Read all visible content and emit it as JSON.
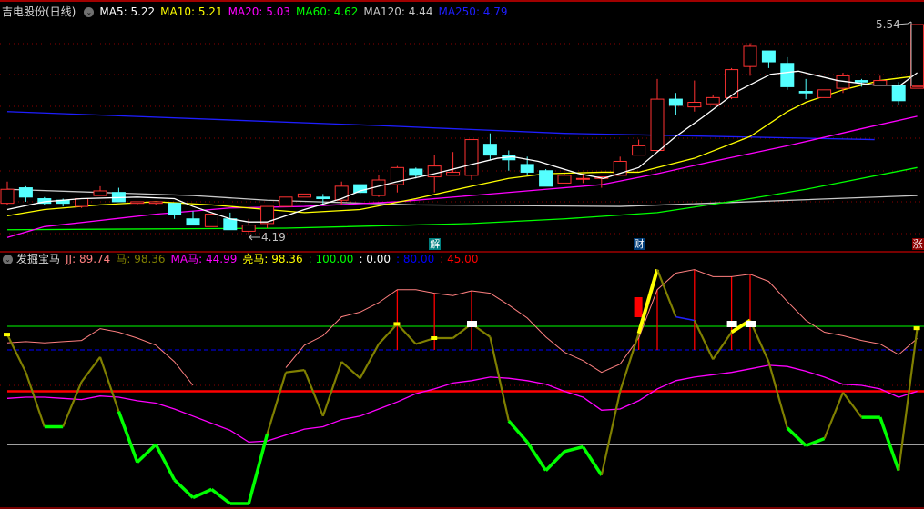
{
  "title": "吉电股份(日线)",
  "ma_labels": [
    {
      "label": "MA5",
      "value": "5.22",
      "color": "#ffffff"
    },
    {
      "label": "MA10",
      "value": "5.21",
      "color": "#ffff00"
    },
    {
      "label": "MA20",
      "value": "5.03",
      "color": "#ff00ff"
    },
    {
      "label": "MA60",
      "value": "4.62",
      "color": "#00ff00"
    },
    {
      "label": "MA120",
      "value": "4.44",
      "color": "#c8c8c8"
    },
    {
      "label": "MA250",
      "value": "4.79",
      "color": "#1e1eff"
    }
  ],
  "indicator": {
    "name": "发掘宝马",
    "items": [
      {
        "label": "JJ",
        "value": "89.74",
        "color": "#ff8080"
      },
      {
        "label": "马",
        "value": "98.36",
        "color": "#808000"
      },
      {
        "label": "MA马",
        "value": "44.99",
        "color": "#ff00ff"
      },
      {
        "label": "亮马",
        "value": "98.36",
        "color": "#ffff00"
      },
      {
        "label": "",
        "value": "100.00",
        "color": "#00ff00"
      },
      {
        "label": "",
        "value": "0.00",
        "color": "#ffffff"
      },
      {
        "label": "",
        "value": "80.00",
        "color": "#0000ff"
      },
      {
        "label": "",
        "value": "45.00",
        "color": "#ff0000"
      }
    ]
  },
  "markers": [
    {
      "text": "解",
      "index": 23,
      "color": "#008080"
    },
    {
      "text": "财",
      "index": 34,
      "color": "#003c78"
    },
    {
      "text": "涨",
      "index": 49,
      "color": "#8b0000"
    }
  ],
  "price_labels": {
    "high": "5.54",
    "low": "4.19",
    "high_index": 49,
    "low_index": 13
  },
  "chart_data": {
    "type": "candlestick",
    "price_range": [
      4.19,
      5.54
    ],
    "candles": [
      [
        4.39,
        4.53,
        4.38,
        4.48
      ],
      [
        4.49,
        4.5,
        4.4,
        4.43
      ],
      [
        4.42,
        4.43,
        4.38,
        4.39
      ],
      [
        4.41,
        4.42,
        4.37,
        4.39
      ],
      [
        4.37,
        4.42,
        4.36,
        4.42
      ],
      [
        4.44,
        4.5,
        4.44,
        4.47
      ],
      [
        4.46,
        4.49,
        4.4,
        4.4
      ],
      [
        4.39,
        4.4,
        4.38,
        4.4
      ],
      [
        4.39,
        4.4,
        4.38,
        4.4
      ],
      [
        4.39,
        4.39,
        4.29,
        4.32
      ],
      [
        4.29,
        4.34,
        4.25,
        4.25
      ],
      [
        4.24,
        4.32,
        4.24,
        4.32
      ],
      [
        4.29,
        4.33,
        4.22,
        4.22
      ],
      [
        4.21,
        4.29,
        4.19,
        4.25
      ],
      [
        4.26,
        4.37,
        4.23,
        4.37
      ],
      [
        4.37,
        4.43,
        4.37,
        4.43
      ],
      [
        4.43,
        4.45,
        4.43,
        4.45
      ],
      [
        4.43,
        4.45,
        4.38,
        4.42
      ],
      [
        4.41,
        4.53,
        4.38,
        4.5
      ],
      [
        4.51,
        4.51,
        4.45,
        4.46
      ],
      [
        4.44,
        4.57,
        4.43,
        4.54
      ],
      [
        4.51,
        4.63,
        4.46,
        4.62
      ],
      [
        4.61,
        4.62,
        4.55,
        4.57
      ],
      [
        4.56,
        4.7,
        4.46,
        4.63
      ],
      [
        4.57,
        4.72,
        4.57,
        4.59
      ],
      [
        4.57,
        4.8,
        4.54,
        4.8
      ],
      [
        4.77,
        4.84,
        4.67,
        4.7
      ],
      [
        4.7,
        4.73,
        4.6,
        4.67
      ],
      [
        4.64,
        4.69,
        4.57,
        4.59
      ],
      [
        4.6,
        4.61,
        4.5,
        4.5
      ],
      [
        4.52,
        4.58,
        4.52,
        4.57
      ],
      [
        4.55,
        4.58,
        4.52,
        4.55
      ],
      [
        4.55,
        4.56,
        4.49,
        4.56
      ],
      [
        4.57,
        4.69,
        4.57,
        4.66
      ],
      [
        4.7,
        4.8,
        4.7,
        4.76
      ],
      [
        4.73,
        5.19,
        4.72,
        5.06
      ],
      [
        5.06,
        5.1,
        4.96,
        5.02
      ],
      [
        5.01,
        5.18,
        4.98,
        5.04
      ],
      [
        5.03,
        5.09,
        5.03,
        5.07
      ],
      [
        5.07,
        5.26,
        5.06,
        5.25
      ],
      [
        5.27,
        5.42,
        5.21,
        5.4
      ],
      [
        5.37,
        5.37,
        5.26,
        5.3
      ],
      [
        5.29,
        5.33,
        5.12,
        5.14
      ],
      [
        5.11,
        5.19,
        5.06,
        5.1
      ],
      [
        5.07,
        5.12,
        5.07,
        5.12
      ],
      [
        5.13,
        5.23,
        5.1,
        5.21
      ],
      [
        5.18,
        5.19,
        5.14,
        5.17
      ],
      [
        5.15,
        5.21,
        5.15,
        5.18
      ],
      [
        5.15,
        5.17,
        5.02,
        5.05
      ],
      [
        5.13,
        5.54,
        5.13,
        5.54
      ]
    ],
    "ma": {
      "MA250": [
        [
          0,
          4.98
        ],
        [
          20,
          4.89
        ],
        [
          30,
          4.84
        ],
        [
          46.7,
          4.8
        ]
      ],
      "MA120": [
        [
          0,
          4.48
        ],
        [
          5,
          4.46
        ],
        [
          10,
          4.44
        ],
        [
          14,
          4.41
        ],
        [
          22,
          4.38
        ],
        [
          33,
          4.37
        ],
        [
          40,
          4.4
        ],
        [
          49,
          4.44
        ]
      ],
      "MA60": [
        [
          0,
          4.22
        ],
        [
          15,
          4.23
        ],
        [
          25,
          4.26
        ],
        [
          30,
          4.29
        ],
        [
          35,
          4.33
        ],
        [
          40,
          4.42
        ],
        [
          43,
          4.48
        ],
        [
          49,
          4.62
        ]
      ],
      "MA20": [
        [
          0,
          4.17
        ],
        [
          2,
          4.24
        ],
        [
          5,
          4.28
        ],
        [
          8,
          4.32
        ],
        [
          12,
          4.36
        ],
        [
          16,
          4.37
        ],
        [
          21,
          4.4
        ],
        [
          25,
          4.44
        ],
        [
          29,
          4.48
        ],
        [
          32,
          4.51
        ],
        [
          35,
          4.58
        ],
        [
          38,
          4.66
        ],
        [
          42,
          4.76
        ],
        [
          46,
          4.87
        ],
        [
          49,
          4.95
        ]
      ],
      "MA10": [
        [
          0,
          4.31
        ],
        [
          2,
          4.35
        ],
        [
          5,
          4.38
        ],
        [
          8,
          4.4
        ],
        [
          11,
          4.38
        ],
        [
          14,
          4.35
        ],
        [
          16,
          4.33
        ],
        [
          19,
          4.35
        ],
        [
          22,
          4.42
        ],
        [
          25,
          4.5
        ],
        [
          27,
          4.55
        ],
        [
          29,
          4.58
        ],
        [
          32,
          4.59
        ],
        [
          34,
          4.59
        ],
        [
          37,
          4.68
        ],
        [
          40,
          4.82
        ],
        [
          42,
          4.98
        ],
        [
          43,
          5.04
        ],
        [
          45,
          5.12
        ],
        [
          47,
          5.18
        ],
        [
          49,
          5.21
        ]
      ],
      "MA5": [
        [
          0,
          4.35
        ],
        [
          2,
          4.4
        ],
        [
          4,
          4.42
        ],
        [
          7,
          4.43
        ],
        [
          9,
          4.42
        ],
        [
          10,
          4.37
        ],
        [
          12,
          4.29
        ],
        [
          13,
          4.27
        ],
        [
          14,
          4.27
        ],
        [
          15,
          4.31
        ],
        [
          16,
          4.35
        ],
        [
          18,
          4.42
        ],
        [
          19,
          4.47
        ],
        [
          21,
          4.53
        ],
        [
          23,
          4.58
        ],
        [
          25,
          4.64
        ],
        [
          26.4,
          4.68
        ],
        [
          27.2,
          4.69
        ],
        [
          28.6,
          4.66
        ],
        [
          29.7,
          4.62
        ],
        [
          30.8,
          4.58
        ],
        [
          32.1,
          4.55
        ],
        [
          34,
          4.62
        ],
        [
          36,
          4.82
        ],
        [
          37.4,
          4.94
        ],
        [
          39.3,
          5.11
        ],
        [
          41.1,
          5.22
        ],
        [
          42.6,
          5.24
        ],
        [
          44.7,
          5.18
        ],
        [
          46.7,
          5.15
        ],
        [
          48.1,
          5.15
        ],
        [
          49,
          5.23
        ]
      ]
    },
    "indicator": {
      "levels": {
        "upper": 100,
        "blue": 80,
        "mid": 45,
        "zero": 0
      },
      "ma_horse": [
        39,
        40,
        40,
        39,
        38,
        41,
        40,
        37,
        35,
        30,
        24,
        18,
        12,
        2,
        3,
        8,
        13,
        15,
        21,
        24,
        30,
        36,
        43,
        47,
        52,
        54,
        57,
        56,
        54,
        51,
        45,
        40,
        29,
        30,
        37,
        47,
        54,
        57,
        59,
        61,
        64,
        67,
        66,
        62,
        57,
        51,
        50,
        47,
        40,
        44.99
      ],
      "jj": [
        86,
        87,
        86,
        87,
        88,
        98,
        95,
        90,
        84,
        70,
        50,
        null,
        null,
        null,
        null,
        65,
        84,
        92,
        108,
        112,
        120,
        131,
        131,
        128,
        126,
        130,
        128,
        118,
        107,
        91,
        78,
        71,
        61,
        68,
        90,
        131,
        145,
        148,
        142,
        142,
        144,
        138,
        121,
        105,
        95,
        92,
        88,
        85,
        76,
        89.74
      ],
      "horse": [
        93,
        61,
        15,
        15,
        53,
        74,
        28,
        -15,
        0,
        -30,
        -45,
        -38,
        -50,
        -50,
        9,
        61,
        63,
        24,
        70,
        56,
        85,
        102,
        85,
        90,
        90,
        102,
        91,
        20,
        2,
        -22,
        -6,
        -2,
        -26,
        45,
        94,
        148,
        108,
        105,
        72,
        95,
        105,
        70,
        14,
        -1,
        5,
        44,
        23,
        23,
        -22,
        98.36
      ],
      "green_segments": [
        2,
        6,
        7,
        8,
        9,
        10,
        11,
        12,
        13,
        27,
        28,
        29,
        30,
        31,
        42,
        43,
        46,
        47
      ],
      "yellow_segments": [
        34,
        39
      ],
      "blue_segments": [
        36
      ],
      "signal_bars": [
        21,
        23,
        25,
        34,
        35,
        37,
        39,
        40
      ],
      "white_squares": [
        25,
        39,
        40
      ],
      "yellow_dots": [
        0,
        21,
        23,
        49
      ],
      "red_block": 34
    }
  }
}
